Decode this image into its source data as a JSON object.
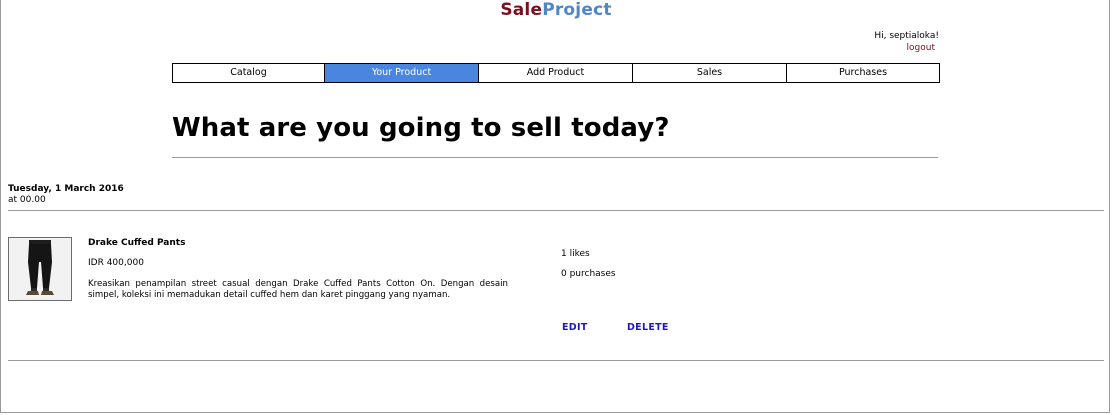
{
  "brand": {
    "part1": "Sale",
    "part2": "Project"
  },
  "user": {
    "greeting": "Hi, septialoka!",
    "logout_label": "logout"
  },
  "nav": {
    "tabs": [
      {
        "label": "Catalog",
        "active": false
      },
      {
        "label": "Your Product",
        "active": true
      },
      {
        "label": "Add Product",
        "active": false
      },
      {
        "label": "Sales",
        "active": false
      },
      {
        "label": "Purchases",
        "active": false
      }
    ]
  },
  "page": {
    "title": "What are you going to sell today?"
  },
  "products": [
    {
      "date": "Tuesday, 1 March 2016",
      "time": "at 00.00",
      "name": "Drake Cuffed Pants",
      "price": "IDR 400,000",
      "description": "Kreasikan penampilan street casual dengan Drake Cuffed Pants Cotton On. Dengan desain simpel, koleksi ini memadukan detail cuffed hem dan karet pinggang yang nyaman.",
      "likes": "1 likes",
      "purchases": "0 purchases",
      "edit_label": "EDIT",
      "delete_label": "DELETE",
      "thumbnail_icon": "pants-product-image"
    }
  ],
  "colors": {
    "brand_sale": "#7a0e1c",
    "brand_project": "#4f86c6",
    "active_tab": "#4a86e0",
    "action_link": "#1f18c8"
  }
}
